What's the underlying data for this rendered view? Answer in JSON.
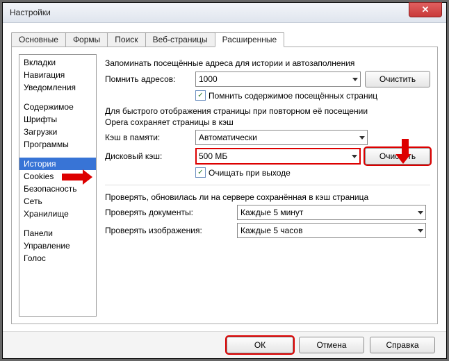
{
  "window": {
    "title": "Настройки",
    "close_glyph": "✕"
  },
  "tabs": [
    {
      "label": "Основные"
    },
    {
      "label": "Формы"
    },
    {
      "label": "Поиск"
    },
    {
      "label": "Веб-страницы"
    },
    {
      "label": "Расширенные",
      "active": true
    }
  ],
  "nav_groups": [
    [
      "Вкладки",
      "Навигация",
      "Уведомления"
    ],
    [
      "Содержимое",
      "Шрифты",
      "Загрузки",
      "Программы"
    ],
    [
      "История",
      "Cookies",
      "Безопасность",
      "Сеть",
      "Хранилище"
    ],
    [
      "Панели",
      "Управление",
      "Голос"
    ]
  ],
  "nav_selected": "История",
  "history": {
    "remember_desc": "Запоминать посещённые адреса для истории и автозаполнения",
    "remember_label": "Помнить адресов:",
    "remember_value": "1000",
    "clear1_label": "Очистить",
    "remember_content_label": "Помнить содержимое посещённых страниц",
    "cache_desc1": "Для быстрого отображения страницы при повторном её посещении",
    "cache_desc2": "Opera сохраняет страницы в кэш",
    "mem_cache_label": "Кэш в памяти:",
    "mem_cache_value": "Автоматически",
    "disk_cache_label": "Дисковый кэш:",
    "disk_cache_value": "500 МБ",
    "clear2_label": "Очистить",
    "clear_on_exit_label": "Очищать при выходе",
    "check_desc": "Проверять, обновилась ли на сервере сохранённая в кэш страница",
    "check_docs_label": "Проверять документы:",
    "check_docs_value": "Каждые 5 минут",
    "check_images_label": "Проверять изображения:",
    "check_images_value": "Каждые 5 часов"
  },
  "buttons": {
    "ok": "ОК",
    "cancel": "Отмена",
    "help": "Справка"
  },
  "checkmark": "✓"
}
